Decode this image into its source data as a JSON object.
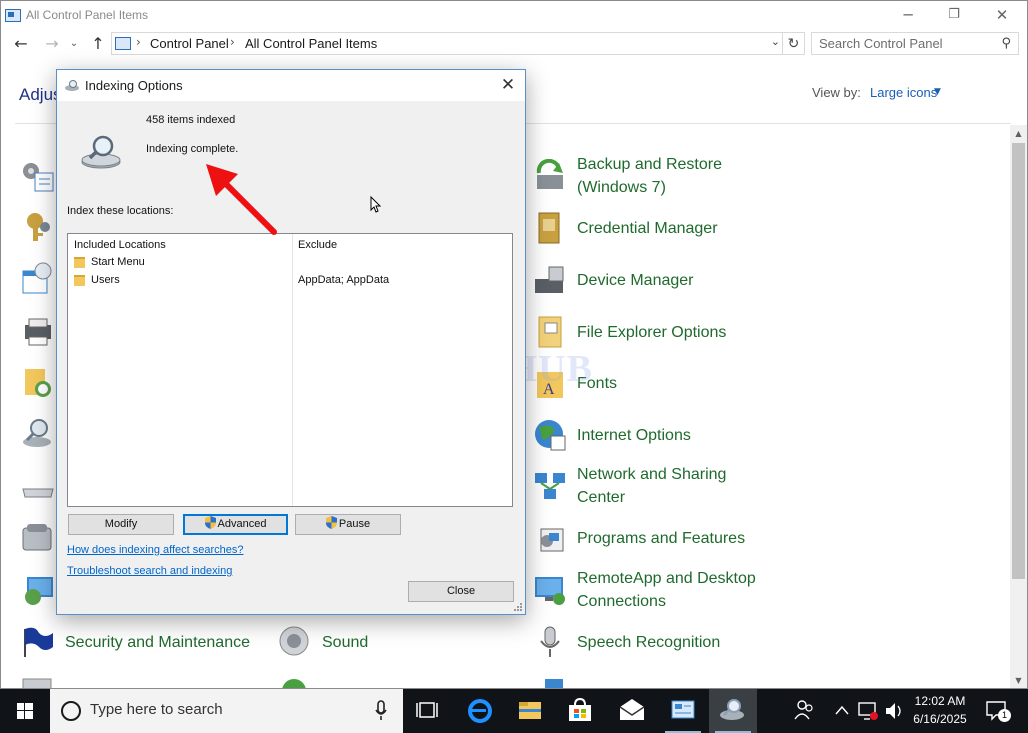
{
  "window": {
    "title": "All Control Panel Items",
    "min_icon": "minimize-icon",
    "max_icon": "maximize-icon",
    "close_icon": "close-icon"
  },
  "nav": {
    "back_icon": "back-arrow-icon",
    "forward_icon": "forward-arrow-icon",
    "up_icon": "up-arrow-icon",
    "breadcrumb": [
      "Control Panel",
      "All Control Panel Items"
    ],
    "refresh_icon": "refresh-icon",
    "search_placeholder": "Search Control Panel"
  },
  "header": {
    "heading_partial": "Adjus",
    "view_by_label": "View by:",
    "view_by_value": "Large icons"
  },
  "items_left_hidden_icons": [
    "admin-tools-icon",
    "credential-key-icon",
    "date-time-icon",
    "devices-printers-icon",
    "file-history-icon",
    "indexing-icon",
    "keyboard-icon",
    "phone-modem-icon",
    "recovery-icon"
  ],
  "items_right": [
    {
      "label": "Backup and Restore",
      "label2": "(Windows 7)",
      "icon": "backup-restore-icon"
    },
    {
      "label": "Credential Manager",
      "icon": "credential-manager-icon"
    },
    {
      "label": "Device Manager",
      "icon": "device-manager-icon"
    },
    {
      "label": "File Explorer Options",
      "icon": "file-explorer-options-icon"
    },
    {
      "label": "Fonts",
      "icon": "fonts-icon"
    },
    {
      "label": "Internet Options",
      "icon": "internet-options-icon"
    },
    {
      "label": "Network and Sharing",
      "label2": "Center",
      "icon": "network-sharing-icon"
    },
    {
      "label": "Programs and Features",
      "icon": "programs-features-icon"
    },
    {
      "label": "RemoteApp and Desktop",
      "label2": "Connections",
      "icon": "remoteapp-icon"
    },
    {
      "label": "Speech Recognition",
      "icon": "microphone-icon"
    }
  ],
  "items_bottom": [
    {
      "label": "Security and Maintenance",
      "icon": "flag-icon"
    },
    {
      "label": "Sound",
      "icon": "speaker-icon"
    }
  ],
  "dialog": {
    "title": "Indexing Options",
    "items_indexed": "458 items indexed",
    "status": "Indexing complete.",
    "index_locations_label": "Index these locations:",
    "col_included": "Included Locations",
    "col_exclude": "Exclude",
    "rows": [
      {
        "location": "Start Menu",
        "exclude": ""
      },
      {
        "location": "Users",
        "exclude": "AppData; AppData"
      }
    ],
    "btn_modify": "Modify",
    "btn_advanced": "Advanced",
    "btn_pause": "Pause",
    "link_affect": "How does indexing affect searches?",
    "link_troubleshoot": "Troubleshoot search and indexing",
    "btn_close": "Close"
  },
  "watermark": "IT Pros HUB",
  "taskbar": {
    "search_text": "Type here to search",
    "time": "12:02 AM",
    "date": "6/16/2025",
    "notification_count": "1",
    "pinned_icons": [
      "task-view-icon",
      "edge-icon",
      "file-explorer-icon",
      "store-icon",
      "mail-icon",
      "control-panel-icon",
      "indexing-options-icon"
    ]
  },
  "colors": {
    "link_green": "#1f6a2c",
    "accent_blue": "#0078d7",
    "taskbar": "#101418"
  }
}
